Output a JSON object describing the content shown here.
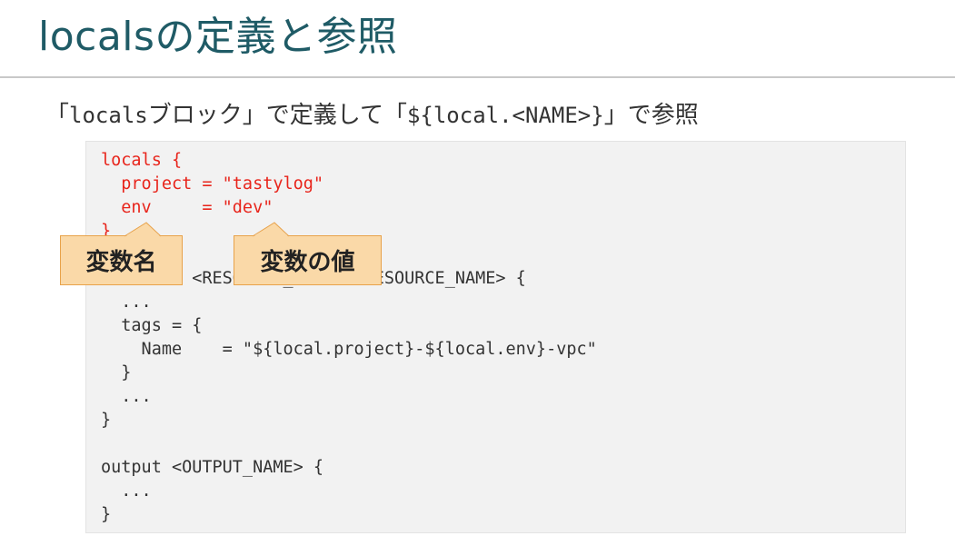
{
  "slide": {
    "title": "localsの定義と参照",
    "subtitle": {
      "open": "「",
      "code1": "locals",
      "mid": "ブロック」で定義して「",
      "code2": "${local.<NAME>}",
      "end": "」で参照"
    }
  },
  "code": {
    "lines": [
      "locals {",
      "  project = \"tastylog\"",
      "  env     = \"dev\"",
      "}",
      "",
      "resource <RESOURCE_TYPE> <RESOURCE_NAME> {",
      "  ...",
      "  tags = {",
      "    Name    = \"${local.project}-${local.env}-vpc\"",
      "  }",
      "  ...",
      "}",
      "",
      "output <OUTPUT_NAME> {",
      "  ...",
      "}"
    ],
    "highlight_color": "#e8251c"
  },
  "callouts": {
    "var_name": "変数名",
    "var_value": "変数の値"
  },
  "colors": {
    "title": "#1f5b66",
    "callout_fill": "#fad9a8",
    "callout_border": "#e8a24a",
    "code_background": "#f2f2f2"
  }
}
